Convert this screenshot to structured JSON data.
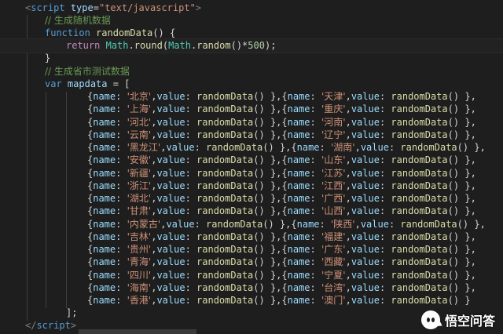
{
  "script_open": {
    "tag": "script",
    "attr": "type",
    "value": "\"text/javascript\""
  },
  "comment_generate_random": "// 生成随机数据",
  "fn_decl": {
    "keyword": "function",
    "name": "randomData",
    "tail": "() {"
  },
  "fn_return": {
    "keyword": "return",
    "obj": "Math",
    "round": "round",
    "random": "random",
    "number": "500"
  },
  "fn_close": "}",
  "comment_generate_provinces": "// 生成省市测试数据",
  "var_decl": {
    "keyword": "var",
    "name": "mapdata",
    "tail": " = ["
  },
  "entries": [
    [
      "北京",
      "天津"
    ],
    [
      "上海",
      "重庆"
    ],
    [
      "河北",
      "河南"
    ],
    [
      "云南",
      "辽宁"
    ],
    [
      "黑龙江",
      "湖南"
    ],
    [
      "安徽",
      "山东"
    ],
    [
      "新疆",
      "江苏"
    ],
    [
      "浙江",
      "江西"
    ],
    [
      "湖北",
      "广西"
    ],
    [
      "甘肃",
      "山西"
    ],
    [
      "内蒙古",
      "陕西"
    ],
    [
      "吉林",
      "福建"
    ],
    [
      "贵州",
      "广东"
    ],
    [
      "青海",
      "西藏"
    ],
    [
      "四川",
      "宁夏"
    ],
    [
      "海南",
      "台湾"
    ],
    [
      "香港",
      "澳门"
    ]
  ],
  "entry_keys": {
    "name": "name",
    "value": "value",
    "call": "randomData"
  },
  "array_close": "];",
  "script_close": "script",
  "watermark": {
    "text": "悟空问答",
    "icon": "wukong-logo-icon"
  },
  "colors": {
    "background": "#1e1e1e",
    "keyword": "#569cd6",
    "string": "#ce9178",
    "comment": "#6a9955",
    "function": "#dcdcaa",
    "number": "#b5cea8",
    "variable": "#9cdcfe"
  }
}
